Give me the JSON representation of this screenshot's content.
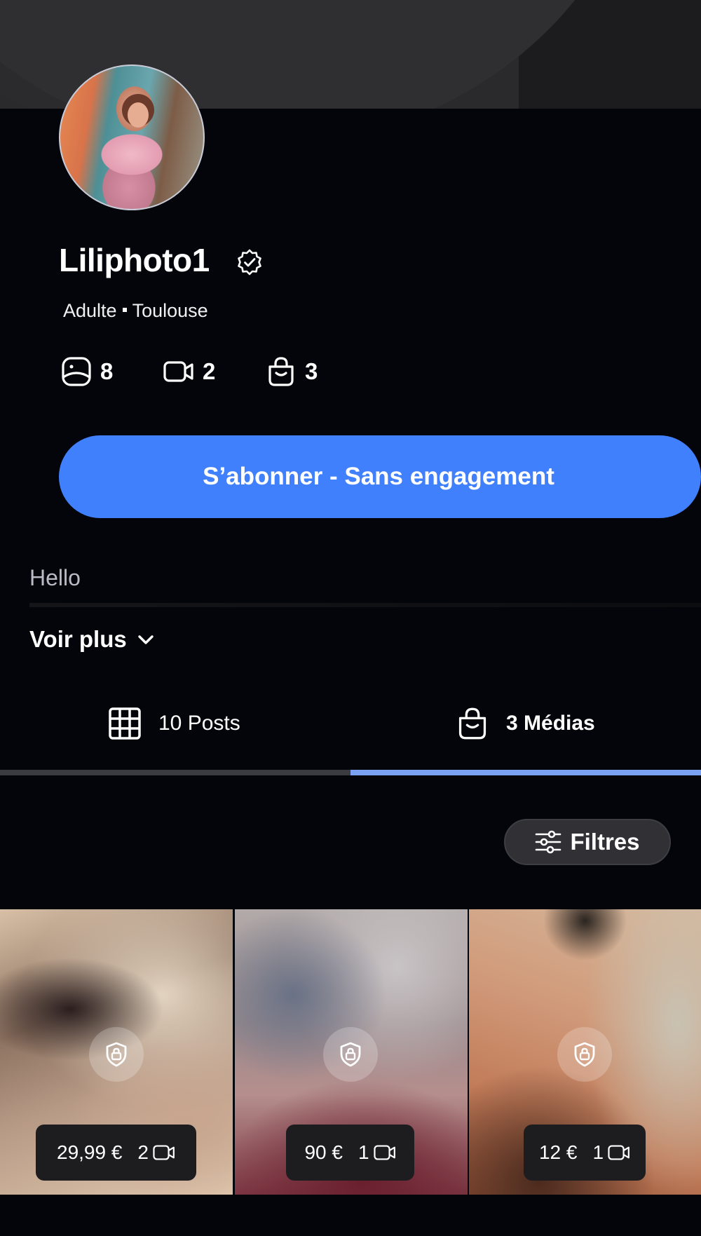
{
  "profile": {
    "username": "Liliphoto1",
    "category": "Adulte",
    "location": "Toulouse",
    "stats": {
      "photos": "8",
      "videos": "2",
      "medias": "3"
    },
    "subscribe_label": "S’abonner - Sans engagement",
    "bio": "Hello",
    "see_more_label": "Voir plus"
  },
  "tabs": [
    {
      "label": "10 Posts",
      "icon": "grid-icon",
      "active": false
    },
    {
      "label": "3 Médias",
      "icon": "shopping-bag-icon",
      "active": true
    }
  ],
  "filters_label": "Filtres",
  "media": [
    {
      "price": "29,99 €",
      "video_count": "2",
      "locked": true
    },
    {
      "price": "90 €",
      "video_count": "1",
      "locked": true
    },
    {
      "price": "12 €",
      "video_count": "1",
      "locked": true
    }
  ],
  "colors": {
    "background": "#03050a",
    "accent": "#4080fc",
    "active_tab_underline": "#7ba1f2"
  }
}
